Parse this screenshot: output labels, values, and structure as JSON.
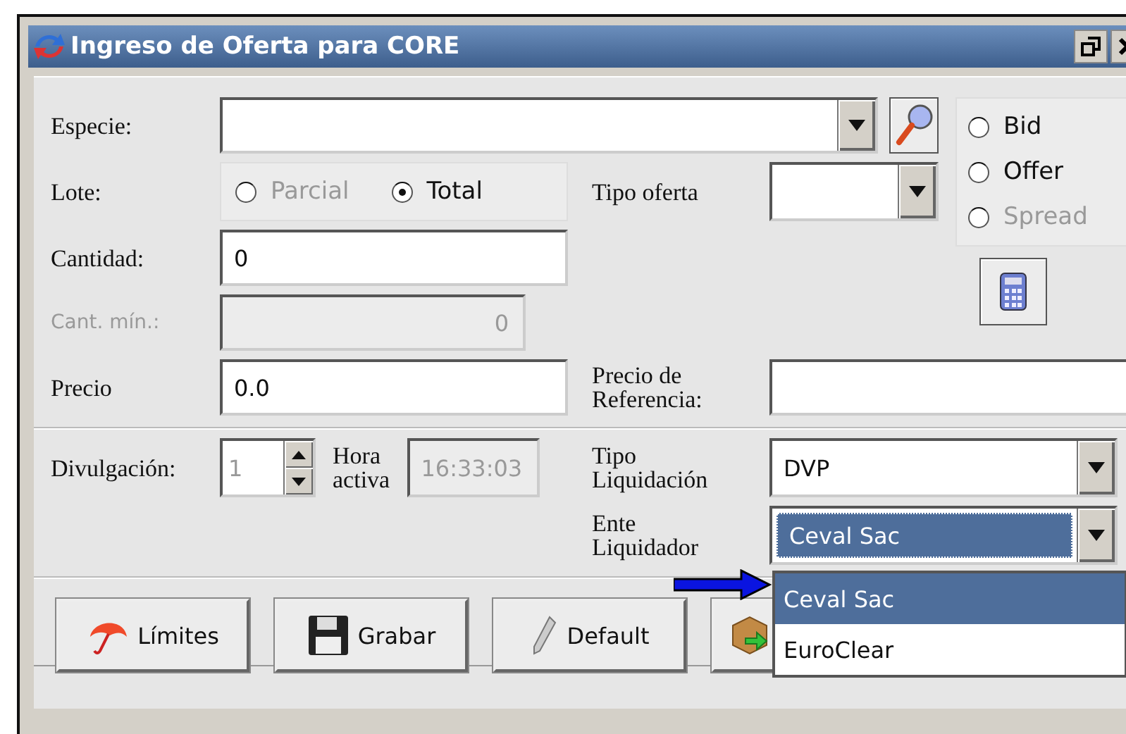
{
  "window": {
    "title": "Ingreso de Oferta para CORE"
  },
  "especie": {
    "label": "Especie:"
  },
  "side_radios": [
    {
      "label": "Bid",
      "selected": false,
      "disabled": false
    },
    {
      "label": "Offer",
      "selected": false,
      "disabled": false
    },
    {
      "label": "Spread",
      "selected": false,
      "disabled": true
    }
  ],
  "lote": {
    "label": "Lote:",
    "options": [
      {
        "label": "Parcial",
        "selected": false,
        "disabled": true
      },
      {
        "label": "Total",
        "selected": true,
        "disabled": false
      }
    ]
  },
  "tipo_oferta": {
    "label": "Tipo oferta"
  },
  "cantidad": {
    "label": "Cantidad:",
    "value": "0"
  },
  "cant_min": {
    "label": "Cant. mín.:",
    "value": "0",
    "disabled": true
  },
  "precio": {
    "label": "Precio",
    "value": "0.0"
  },
  "precio_referencia": {
    "label": "Precio de Referencia:"
  },
  "divulgacion": {
    "label": "Divulgación:",
    "value": "1",
    "disabled": true
  },
  "hora_activa": {
    "label": "Hora activa",
    "value": "16:33:03",
    "disabled": true
  },
  "tipo_liquidacion": {
    "label": "Tipo Liquidación",
    "value": "DVP"
  },
  "ente_liquidador": {
    "label": "Ente Liquidador",
    "value": "Ceval Sac",
    "expanded": true,
    "options": [
      {
        "label": "Ceval Sac",
        "selected": true
      },
      {
        "label": "EuroClear",
        "selected": false
      }
    ]
  },
  "buttons": [
    {
      "kind": "umbrella",
      "label": "Límites"
    },
    {
      "kind": "floppy",
      "label": "Grabar"
    },
    {
      "kind": "pen",
      "label": "Default"
    },
    {
      "kind": "box"
    }
  ]
}
